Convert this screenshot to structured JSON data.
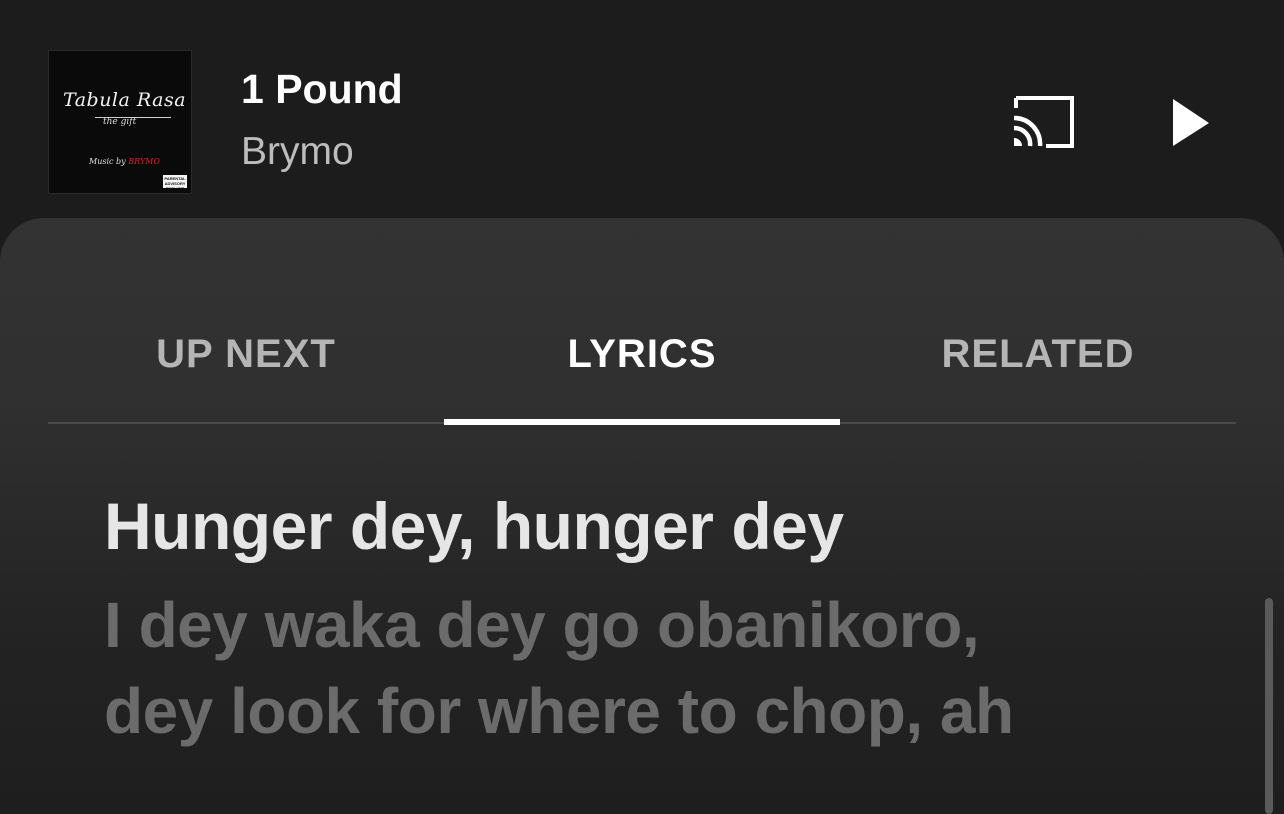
{
  "now_playing": {
    "title": "1 Pound",
    "artist": "Brymo",
    "album_art": {
      "title": "Tabula Rasa",
      "subtitle": "the gift",
      "credit_prefix": "Music by",
      "credit_artist": "BRYMO",
      "advisory": "PARENTAL ADVISORY EXPLICIT CONTENT"
    }
  },
  "controls": {
    "cast_icon": "cast-icon",
    "play_icon": "play-icon"
  },
  "tabs": [
    {
      "label": "UP NEXT",
      "active": false
    },
    {
      "label": "LYRICS",
      "active": true
    },
    {
      "label": "RELATED",
      "active": false
    }
  ],
  "lyrics": {
    "current_line": "Hunger dey, hunger dey",
    "next_lines": [
      "I dey waka dey go obanikoro,",
      "dey look for where to chop, ah"
    ]
  },
  "colors": {
    "background": "#1c1c1c",
    "sheet": "#333333",
    "active_text": "#ffffff",
    "inactive_text": "#b5b5b5",
    "upcoming_lyric": "#6b6b6b"
  }
}
